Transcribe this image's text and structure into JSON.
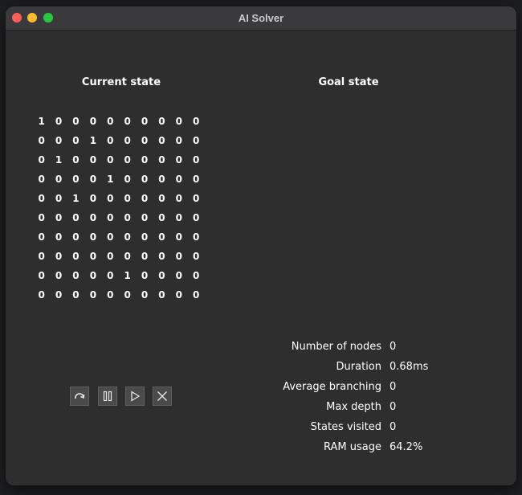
{
  "window": {
    "title": "AI Solver"
  },
  "current_state": {
    "title": "Current state",
    "rows": [
      [
        1,
        0,
        0,
        0,
        0,
        0,
        0,
        0,
        0,
        0
      ],
      [
        0,
        0,
        0,
        1,
        0,
        0,
        0,
        0,
        0,
        0
      ],
      [
        0,
        1,
        0,
        0,
        0,
        0,
        0,
        0,
        0,
        0
      ],
      [
        0,
        0,
        0,
        0,
        1,
        0,
        0,
        0,
        0,
        0
      ],
      [
        0,
        0,
        1,
        0,
        0,
        0,
        0,
        0,
        0,
        0
      ],
      [
        0,
        0,
        0,
        0,
        0,
        0,
        0,
        0,
        0,
        0
      ],
      [
        0,
        0,
        0,
        0,
        0,
        0,
        0,
        0,
        0,
        0
      ],
      [
        0,
        0,
        0,
        0,
        0,
        0,
        0,
        0,
        0,
        0
      ],
      [
        0,
        0,
        0,
        0,
        0,
        1,
        0,
        0,
        0,
        0
      ],
      [
        0,
        0,
        0,
        0,
        0,
        0,
        0,
        0,
        0,
        0
      ]
    ]
  },
  "goal_state": {
    "title": "Goal state"
  },
  "controls": [
    {
      "name": "step-button",
      "icon": "redo-arrow-icon"
    },
    {
      "name": "pause-button",
      "icon": "pause-icon"
    },
    {
      "name": "play-button",
      "icon": "play-icon"
    },
    {
      "name": "stop-button",
      "icon": "close-icon"
    }
  ],
  "stats": [
    {
      "label": "Number of nodes",
      "value": "0"
    },
    {
      "label": "Duration",
      "value": "0.68ms"
    },
    {
      "label": "Average branching",
      "value": "0"
    },
    {
      "label": "Max depth",
      "value": "0"
    },
    {
      "label": "States visited",
      "value": "0"
    },
    {
      "label": "RAM usage",
      "value": "64.2%"
    }
  ],
  "colors": {
    "window_bg": "#2e2e2e",
    "titlebar_bg": "#3a3a3c",
    "traffic_red": "#ff5f57",
    "traffic_yellow": "#febc2e",
    "traffic_green": "#28c840"
  }
}
